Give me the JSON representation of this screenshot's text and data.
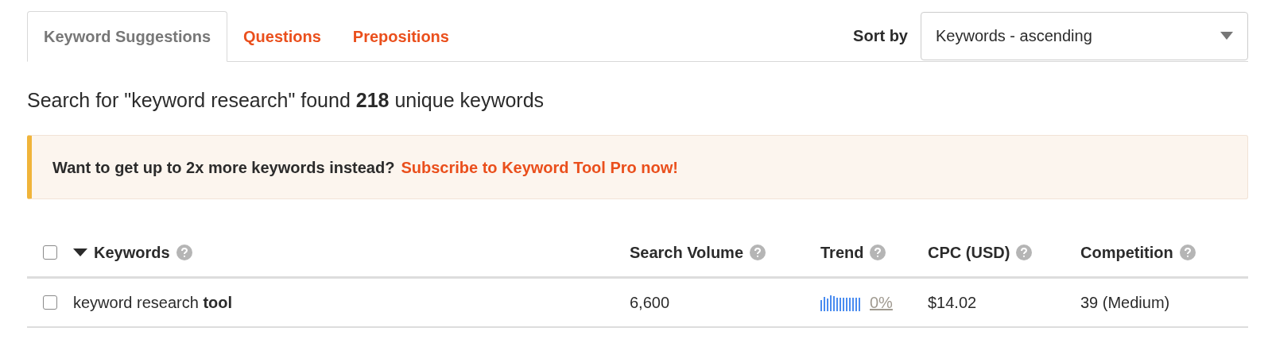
{
  "tabs": [
    {
      "label": "Keyword Suggestions",
      "selected": true
    },
    {
      "label": "Questions",
      "selected": false
    },
    {
      "label": "Prepositions",
      "selected": false
    }
  ],
  "sort": {
    "label": "Sort by",
    "value": "Keywords - ascending"
  },
  "summary": "Search for \"keyword research\" found **218** unique keywords",
  "banner": {
    "text": "Want to get up to 2x more keywords instead?",
    "link": "Subscribe to Keyword Tool Pro now!"
  },
  "table": {
    "select_all_checked": false,
    "columns": [
      {
        "label": "Keywords",
        "sorted": true
      },
      {
        "label": "Search Volume",
        "sorted": false
      },
      {
        "label": "Trend",
        "sorted": false
      },
      {
        "label": "CPC (USD)",
        "sorted": false
      },
      {
        "label": "Competition",
        "sorted": false
      }
    ],
    "rows": [
      {
        "checked": false,
        "keyword": "keyword research **tool**",
        "volume": "6,600",
        "trend": "0%",
        "cpc": "$14.02",
        "competition": "39 (Medium)"
      }
    ]
  }
}
